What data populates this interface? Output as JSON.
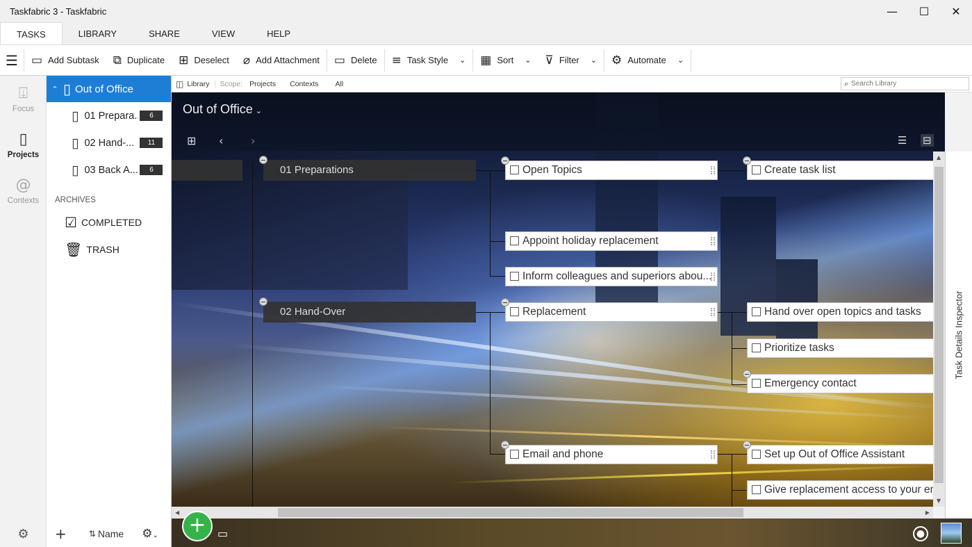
{
  "window": {
    "title": "Taskfabric 3 - Taskfabric",
    "minimize": "—",
    "maximize": "☐",
    "close": "✕"
  },
  "ribbon_tabs": [
    "TASKS",
    "LIBRARY",
    "SHARE",
    "VIEW",
    "HELP"
  ],
  "toolbar": {
    "menu_icon": "☰",
    "add_subtask": "Add Subtask",
    "duplicate": "Duplicate",
    "deselect": "Deselect",
    "add_attachment": "Add Attachment",
    "delete": "Delete",
    "task_style": "Task Style",
    "sort": "Sort",
    "filter": "Filter",
    "automate": "Automate"
  },
  "rail": {
    "focus": "Focus",
    "projects": "Projects",
    "contexts": "Contexts"
  },
  "sidebar": {
    "root": "Out of Office",
    "children": [
      {
        "name": "01 Prepara...",
        "count": "6"
      },
      {
        "name": "02 Hand-...",
        "count": "11"
      },
      {
        "name": "03 Back A...",
        "count": "6"
      }
    ],
    "archives_heading": "ARCHIVES",
    "completed": "COMPLETED",
    "trash": "TRASH",
    "sort_label": "Name"
  },
  "scopebar": {
    "library": "Library",
    "scope": "Scope:",
    "projects": "Projects",
    "contexts": "Contexts",
    "all": "All",
    "search_placeholder": "Search Library"
  },
  "canvas": {
    "title": "Out of Office",
    "nodes": {
      "prep": "01 Preparations",
      "handover": "02 Hand-Over",
      "open_topics": "Open Topics",
      "appoint": "Appoint holiday replacement",
      "inform": "Inform colleagues and superiors abou...",
      "replacement": "Replacement",
      "email_phone": "Email and phone",
      "create_list": "Create task list",
      "hand_over_topics": "Hand over open topics and tasks",
      "prioritize": "Prioritize tasks",
      "emergency": "Emergency contact",
      "ooo_assistant": "Set up Out of Office Assistant",
      "give_access": "Give replacement access to your em"
    }
  },
  "inspector": {
    "label": "Task Details Inspector"
  },
  "colors": {
    "accent": "#1e7ed6",
    "add_button": "#35b34a"
  }
}
